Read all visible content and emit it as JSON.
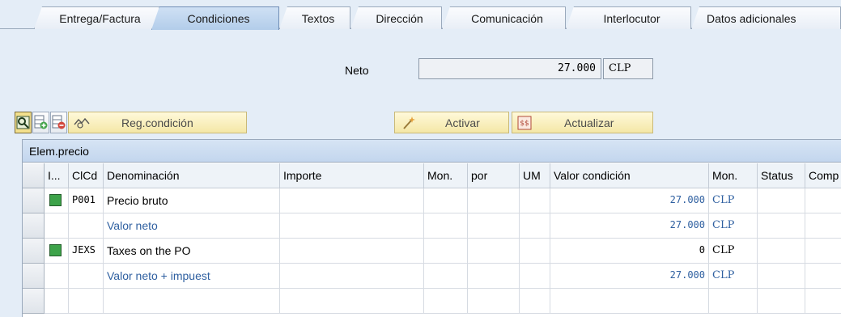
{
  "tabs": [
    {
      "label": "Entrega/Factura"
    },
    {
      "label": "Condiciones"
    },
    {
      "label": "Textos"
    },
    {
      "label": "Dirección"
    },
    {
      "label": "Comunicación"
    },
    {
      "label": "Interlocutor"
    },
    {
      "label": "Datos adicionales"
    }
  ],
  "active_tab": "Condiciones",
  "neto": {
    "label": "Neto",
    "value": "27.000",
    "currency": "CLP"
  },
  "toolbar": {
    "detail_icon": "detail-icon",
    "add_icon": "insert-row-icon",
    "remove_icon": "delete-row-icon",
    "reg_condicion_label": "Reg.condición",
    "activar_label": "Activar",
    "actualizar_label": "Actualizar"
  },
  "grid": {
    "title": "Elem.precio",
    "headers": [
      "I...",
      "ClCd",
      "Denominación",
      "Importe",
      "Mon.",
      "por",
      "UM",
      "Valor condición",
      "Mon.",
      "Status",
      "Comp"
    ],
    "rows": [
      {
        "status": "green",
        "clcd": "P001",
        "denominacion": "Precio bruto",
        "valor": "27.000",
        "mon": "CLP",
        "subtotal": false
      },
      {
        "status": "",
        "clcd": "",
        "denominacion": "Valor neto",
        "valor": "27.000",
        "mon": "CLP",
        "subtotal": true
      },
      {
        "status": "green",
        "clcd": "JEXS",
        "denominacion": "Taxes on the PO",
        "valor": "0",
        "mon": "CLP",
        "subtotal": false
      },
      {
        "status": "",
        "clcd": "",
        "denominacion": "Valor neto + impuest",
        "valor": "27.000",
        "mon": "CLP",
        "subtotal": true
      }
    ]
  },
  "colors": {
    "subtotal_text": "#2e5fa0",
    "status_green": "#3da34a",
    "button_yellow": "#f4e7a6"
  }
}
